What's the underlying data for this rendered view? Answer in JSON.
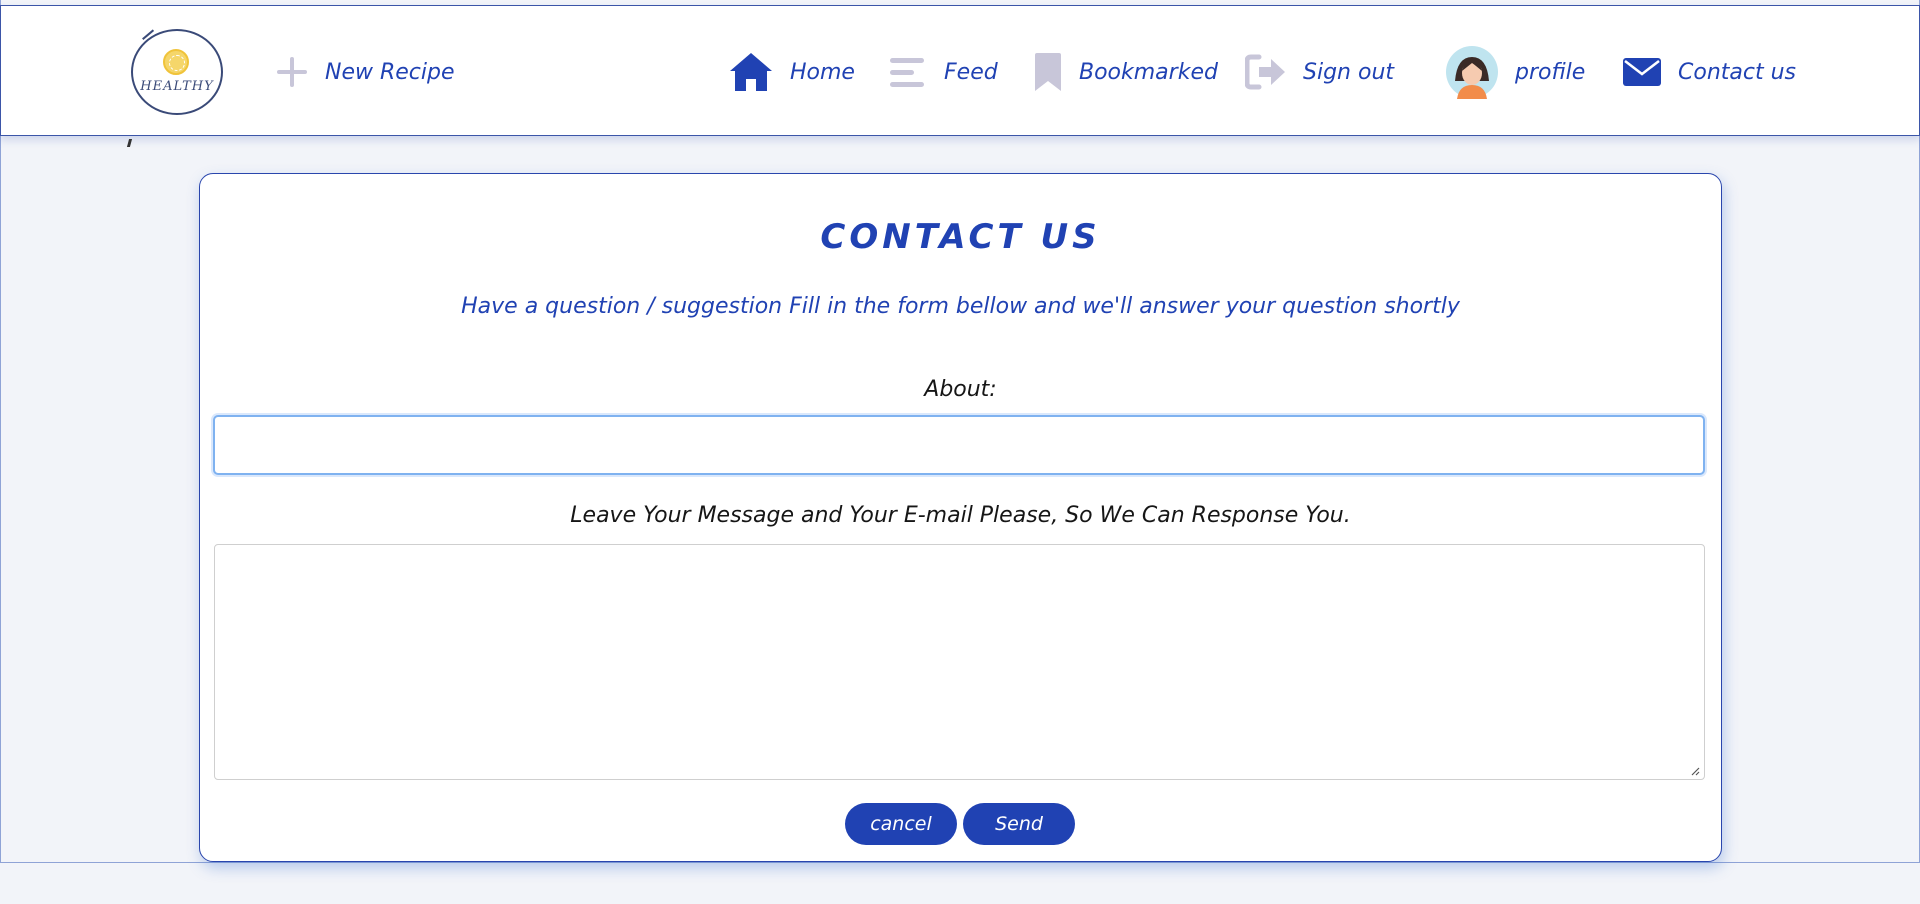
{
  "header": {
    "logo_text": "HEALTHY",
    "new_recipe": {
      "label": "New Recipe",
      "icon": "plus-icon"
    },
    "nav": [
      {
        "label": "Home",
        "icon": "home-icon"
      },
      {
        "label": "Feed",
        "icon": "feed-icon"
      },
      {
        "label": "Bookmarked",
        "icon": "bookmark-icon"
      },
      {
        "label": "Sign out",
        "icon": "sign-out-icon"
      },
      {
        "label": "profile",
        "icon": "avatar"
      },
      {
        "label": "Contact us",
        "icon": "envelope-icon"
      }
    ]
  },
  "stray_mark": "'",
  "contact": {
    "title": "CONTACT US",
    "subtitle": "Have a question / suggestion Fill in the form bellow and we'll answer your question shortly",
    "about_label": "About:",
    "about_value": "",
    "message_label": "Leave Your Message and Your E-mail Please, So We Can Response You.",
    "message_value": "",
    "cancel_label": "cancel",
    "send_label": "Send"
  },
  "colors": {
    "accent": "#2042b3",
    "icon_muted": "#c8c6d9",
    "background": "#f2f4f9"
  }
}
